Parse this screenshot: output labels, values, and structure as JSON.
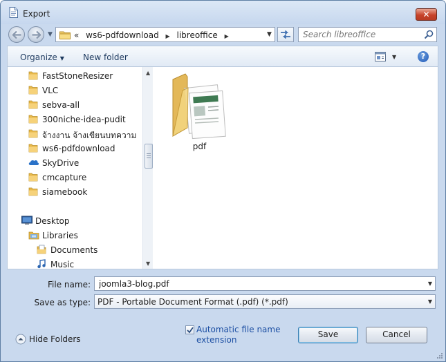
{
  "window": {
    "title": "Export",
    "close_label": "✕"
  },
  "address": {
    "overflow": "«",
    "segments": [
      "ws6-pdfdownload",
      "libreoffice"
    ],
    "separator": "▶",
    "dropdown": "▼"
  },
  "search": {
    "placeholder": "Search libreoffice"
  },
  "toolbar": {
    "organize_label": "Organize",
    "organize_caret": "▼",
    "new_folder_label": "New folder",
    "views_caret": "▼",
    "help_label": "?"
  },
  "nav_pane": {
    "items": [
      {
        "label": "FastStoneResizer",
        "icon": "folder-icon"
      },
      {
        "label": "VLC",
        "icon": "folder-icon"
      },
      {
        "label": "sebva-all",
        "icon": "folder-icon"
      },
      {
        "label": "300niche-idea-pudit",
        "icon": "folder-icon"
      },
      {
        "label": "จ้างงาน จ้างเขียนบทความ",
        "icon": "folder-icon"
      },
      {
        "label": "ws6-pdfdownload",
        "icon": "folder-icon"
      },
      {
        "label": "SkyDrive",
        "icon": "skydrive-icon"
      },
      {
        "label": "cmcapture",
        "icon": "folder-icon"
      },
      {
        "label": "siamebook",
        "icon": "folder-icon"
      },
      {
        "label": "Desktop",
        "icon": "desktop-icon"
      },
      {
        "label": "Libraries",
        "icon": "libraries-icon"
      },
      {
        "label": "Documents",
        "icon": "documents-icon"
      },
      {
        "label": "Music",
        "icon": "music-icon"
      }
    ],
    "scroll_up": "▲",
    "scroll_down": "▼"
  },
  "files": [
    {
      "name": "pdf",
      "icon": "folder-with-documents-icon"
    }
  ],
  "form": {
    "file_name_label": "File name:",
    "file_name_value": "joomla3-blog.pdf",
    "save_type_label": "Save as type:",
    "save_type_value": "PDF - Portable Document Format (.pdf) (*.pdf)",
    "dropdown": "▼"
  },
  "footer": {
    "hide_folders_label": "Hide Folders",
    "auto_ext_label": "Automatic file name extension",
    "auto_ext_checked": true,
    "save_label": "Save",
    "cancel_label": "Cancel"
  }
}
